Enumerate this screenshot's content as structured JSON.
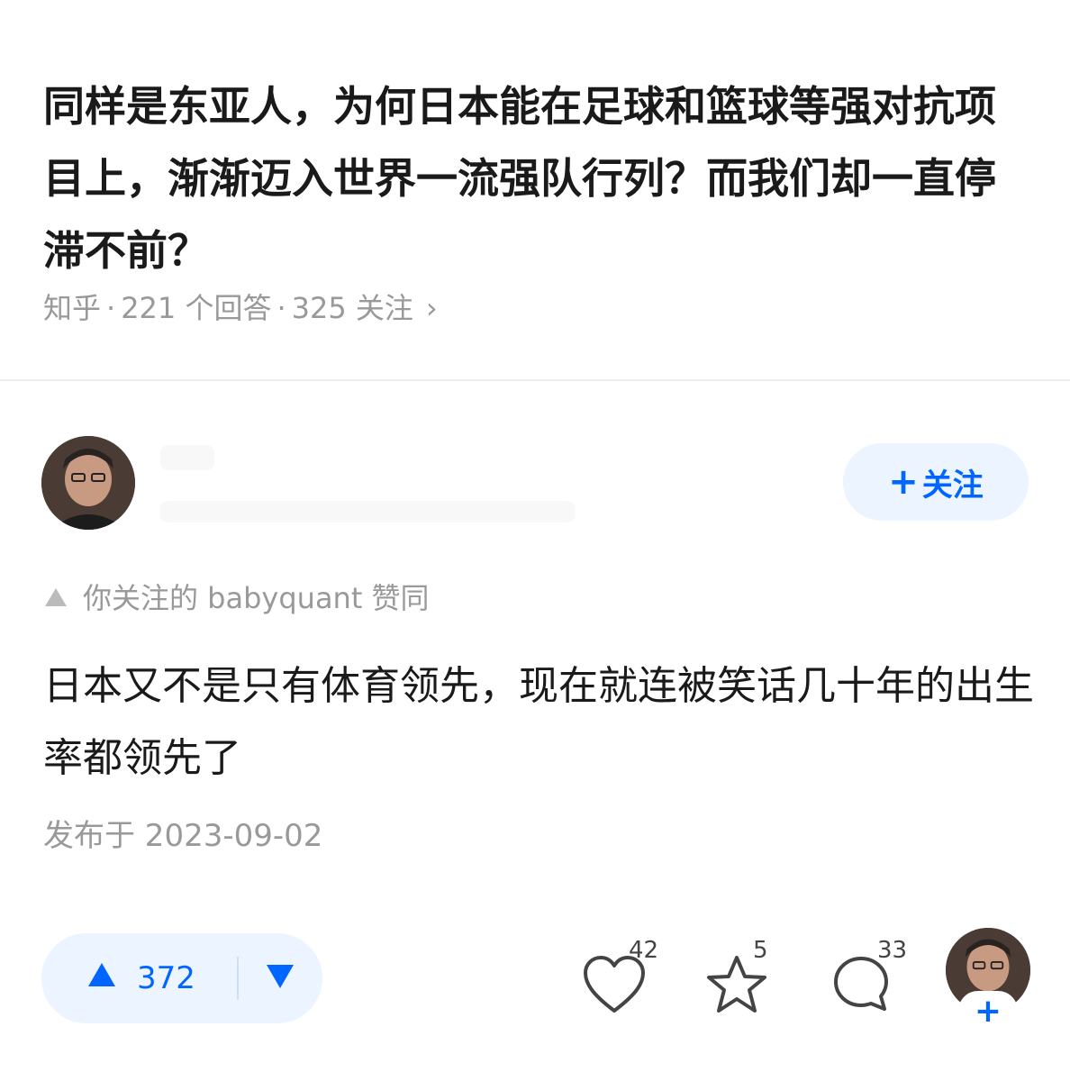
{
  "question": {
    "title": "同样是东亚人，为何日本能在足球和篮球等强对抗项目上，渐渐迈入世界一流强队行列？而我们却一直停滞不前？",
    "meta": {
      "source": "知乎",
      "answers": "221 个回答",
      "followers": "325 关注",
      "separator": "·",
      "chevron": "›"
    }
  },
  "author": {
    "follow_label": "关注",
    "follow_plus": "+"
  },
  "vote_hint": {
    "text": "你关注的 babyquant 赞同"
  },
  "answer": {
    "content": "日本又不是只有体育领先，现在就连被笑话几十年的出生率都领先了",
    "published": "发布于 2023-09-02"
  },
  "actions": {
    "upvotes": "372",
    "likes": "42",
    "favorites": "5",
    "comments": "33",
    "avatar_plus": "+"
  },
  "colors": {
    "accent": "#0066ff",
    "accent_bg": "#ebf4ff",
    "muted": "#999999"
  }
}
